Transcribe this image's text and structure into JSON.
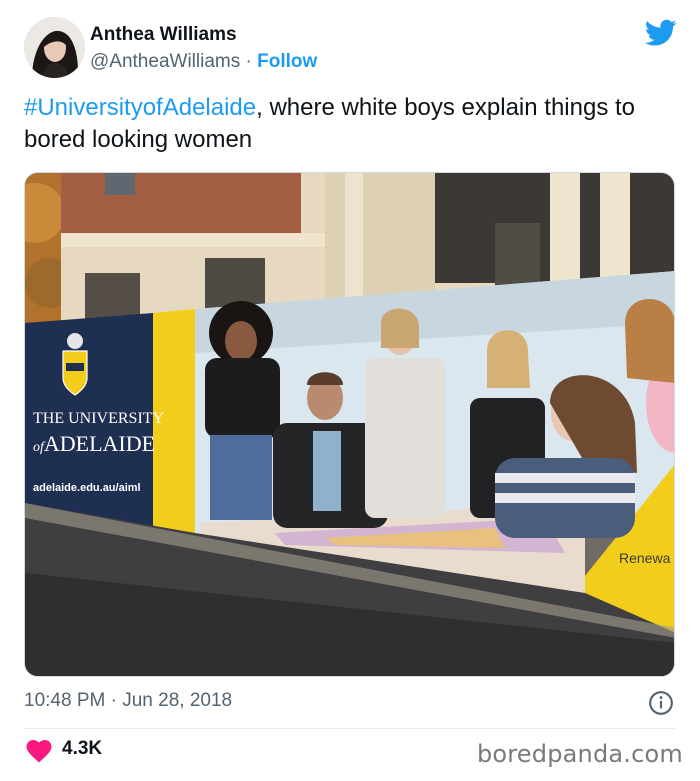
{
  "author": {
    "name": "Anthea Williams",
    "handle": "@AntheaWilliams",
    "separator": "·",
    "follow_label": "Follow"
  },
  "tweet": {
    "hashtag": "#UniversityofAdelaide",
    "text_rest": ", where white boys explain things to bored looking women"
  },
  "media": {
    "banner_title_line1": "THE UNIVERSITY",
    "banner_title_line2": "ADELAIDE",
    "banner_title_prefix": "of",
    "banner_url": "adelaide.edu.au/aiml",
    "corner_text": "Renewa"
  },
  "meta": {
    "time": "10:48 PM",
    "separator": "·",
    "date": "Jun 28, 2018"
  },
  "engagement": {
    "likes": "4.3K"
  },
  "watermark": "boredpanda.com",
  "colors": {
    "link_blue": "#1d9bf0",
    "heart_red": "#f91880",
    "text_dark": "#0f1419",
    "text_gray": "#536471"
  },
  "icons": {
    "brand": "twitter-bird-icon",
    "info": "info-icon",
    "like": "heart-icon"
  }
}
